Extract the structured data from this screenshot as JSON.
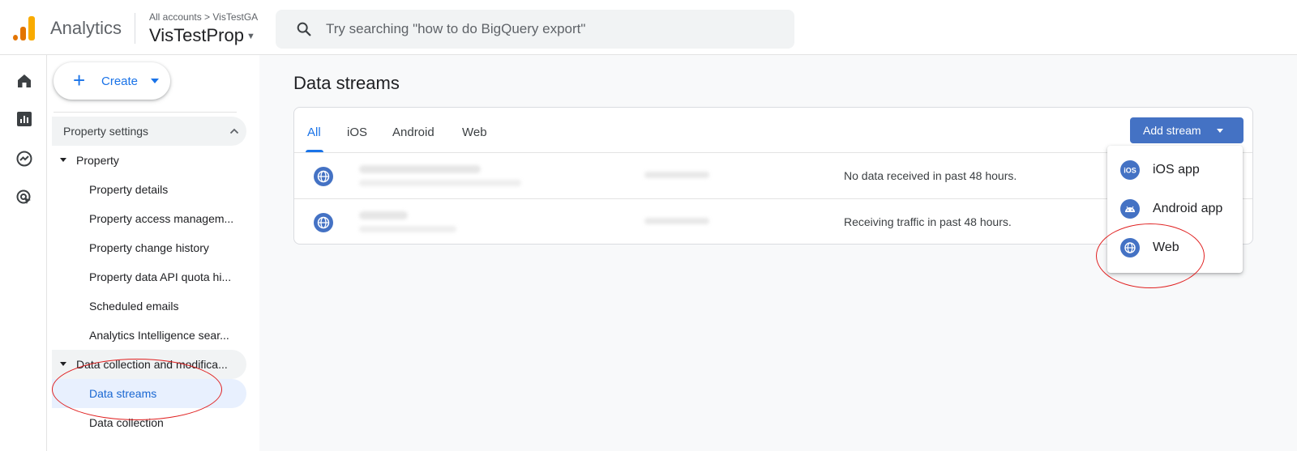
{
  "header": {
    "app_name": "Analytics",
    "breadcrumb": "All accounts > VisTestGA",
    "property_name": "VisTestProp",
    "search_placeholder": "Try searching \"how to do BigQuery export\""
  },
  "rail": {
    "icons": [
      "home-icon",
      "reports-icon",
      "explore-icon",
      "advertising-icon"
    ]
  },
  "sidebar": {
    "create_label": "Create",
    "section_title": "Property settings",
    "items": [
      {
        "label": "Property",
        "type": "group"
      },
      {
        "label": "Property details",
        "type": "item"
      },
      {
        "label": "Property access managem...",
        "type": "item"
      },
      {
        "label": "Property change history",
        "type": "item"
      },
      {
        "label": "Property data API quota hi...",
        "type": "item"
      },
      {
        "label": "Scheduled emails",
        "type": "item"
      },
      {
        "label": "Analytics Intelligence sear...",
        "type": "item"
      },
      {
        "label": "Data collection and modifica...",
        "type": "group"
      },
      {
        "label": "Data streams",
        "type": "item",
        "active": true
      },
      {
        "label": "Data collection",
        "type": "item"
      }
    ]
  },
  "main": {
    "title": "Data streams",
    "tabs": [
      "All",
      "iOS",
      "Android",
      "Web"
    ],
    "active_tab": "All",
    "add_stream_label": "Add stream",
    "streams": [
      {
        "status": "No data received in past 48 hours."
      },
      {
        "status": "Receiving traffic in past 48 hours."
      }
    ]
  },
  "add_stream_menu": {
    "items": [
      {
        "label": "iOS app",
        "icon": "ios-icon"
      },
      {
        "label": "Android app",
        "icon": "android-icon"
      },
      {
        "label": "Web",
        "icon": "globe-icon"
      }
    ]
  },
  "colors": {
    "accent": "#1a73e8",
    "button": "#4472c4",
    "annotation": "#e02020"
  }
}
